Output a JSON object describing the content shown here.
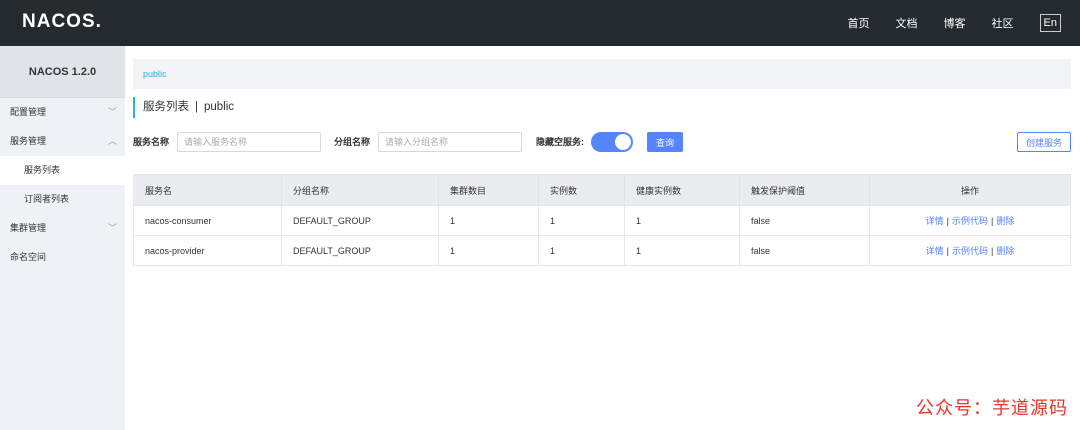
{
  "header": {
    "logo": "NACOS.",
    "nav": [
      "首页",
      "文档",
      "博客",
      "社区"
    ],
    "lang": "En"
  },
  "sidebar": {
    "title": "NACOS 1.2.0",
    "items": [
      {
        "label": "配置管理",
        "chevron": "chevron-down-icon"
      },
      {
        "label": "服务管理",
        "chevron": "chevron-up-icon"
      },
      {
        "label": "服务列表"
      },
      {
        "label": "订阅者列表"
      },
      {
        "label": "集群管理",
        "chevron": "chevron-down-icon"
      },
      {
        "label": "命名空间"
      }
    ]
  },
  "namespace": {
    "current": "public"
  },
  "page": {
    "title": "服务列表",
    "separator": "|",
    "namespace": "public"
  },
  "filter": {
    "service_name_label": "服务名称",
    "service_name_placeholder": "请输入服务名称",
    "group_name_label": "分组名称",
    "group_name_placeholder": "请输入分组名称",
    "hide_empty_label": "隐藏空服务:",
    "query_label": "查询",
    "create_label": "创建服务"
  },
  "table": {
    "columns": [
      "服务名",
      "分组名称",
      "集群数目",
      "实例数",
      "健康实例数",
      "触发保护阈值",
      "操作"
    ],
    "rows": [
      {
        "name": "nacos-consumer",
        "group": "DEFAULT_GROUP",
        "clusters": "1",
        "instances": "1",
        "healthy": "1",
        "threshold": "false"
      },
      {
        "name": "nacos-provider",
        "group": "DEFAULT_GROUP",
        "clusters": "1",
        "instances": "1",
        "healthy": "1",
        "threshold": "false"
      }
    ],
    "ops": {
      "detail": "详情",
      "sample": "示例代码",
      "delete": "删除",
      "sep": "|"
    }
  },
  "watermark": "公众号：芋道源码",
  "colors": {
    "topbar": "#252a2f",
    "accent": "#5584ff",
    "link": "#27b3e0",
    "sidebar": "#eef1f5"
  }
}
